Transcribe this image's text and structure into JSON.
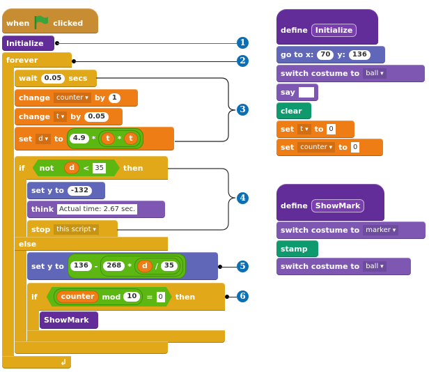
{
  "main_script": {
    "hat": {
      "when": "when",
      "clicked": "clicked",
      "icon": "green-flag-icon"
    },
    "initialize": "Initialize",
    "forever": "forever",
    "wait": {
      "label": "wait",
      "value": "0.05",
      "unit": "secs"
    },
    "change_counter": {
      "label": "change",
      "var": "counter",
      "by": "by",
      "value": "1"
    },
    "change_t": {
      "label": "change",
      "var": "t",
      "by": "by",
      "value": "0.05"
    },
    "set_d": {
      "label": "set",
      "var": "d",
      "to": "to",
      "a": "4.9",
      "op1": "*",
      "b": "t",
      "op2": "*",
      "c": "t"
    },
    "if1": {
      "if": "if",
      "not": "not",
      "var": "d",
      "lt": "<",
      "value": "35",
      "then": "then"
    },
    "set_y1": {
      "label": "set y to",
      "value": "-132"
    },
    "think": {
      "label": "think",
      "value": "Actual time: 2.67 sec."
    },
    "stop": {
      "label": "stop",
      "option": "this script"
    },
    "else": "else",
    "set_y2": {
      "label": "set y to",
      "a": "136",
      "minus": "-",
      "b": "268",
      "mul": "*",
      "var": "d",
      "div": "/",
      "c": "35"
    },
    "if2": {
      "if": "if",
      "var": "counter",
      "mod": "mod",
      "m": "10",
      "eq": "=",
      "value": "0",
      "then": "then"
    },
    "showmark": "ShowMark",
    "loop_arrow": "↲"
  },
  "define_initialize": {
    "define": "define",
    "name": "Initialize",
    "goto": {
      "label": "go to x:",
      "x": "70",
      "ylabel": "y:",
      "y": "136"
    },
    "switch": {
      "label": "switch costume to",
      "value": "ball"
    },
    "say": {
      "label": "say",
      "value": ""
    },
    "clear": "clear",
    "set_t": {
      "label": "set",
      "var": "t",
      "to": "to",
      "value": "0"
    },
    "set_counter": {
      "label": "set",
      "var": "counter",
      "to": "to",
      "value": "0"
    }
  },
  "define_showmark": {
    "define": "define",
    "name": "ShowMark",
    "switch1": {
      "label": "switch costume to",
      "value": "marker"
    },
    "stamp": "stamp",
    "switch2": {
      "label": "switch costume to",
      "value": "ball"
    }
  },
  "callouts": [
    "1",
    "2",
    "3",
    "4",
    "5",
    "6"
  ],
  "colors": {
    "badge": "#0c6fb4",
    "events": "#c88d33",
    "control": "#e1a91a",
    "data": "#ee7d16",
    "motion": "#4a6cd4",
    "looks": "#8a55d7",
    "more_blocks": "#632d99",
    "pen": "#0e9a6c",
    "operators": "#5cb712"
  }
}
